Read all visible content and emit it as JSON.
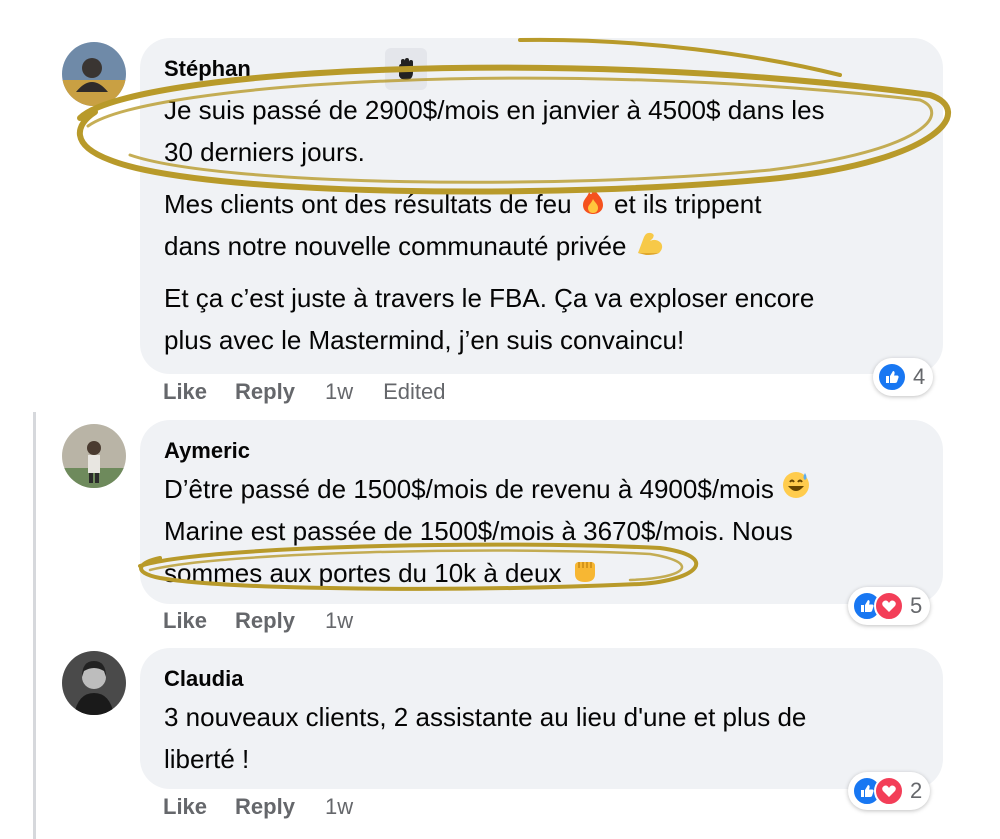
{
  "comments": [
    {
      "author": "Stéphan",
      "paragraphs": [
        [
          "Je suis passé de 2900$/mois en janvier à 4500$ dans les",
          "30 derniers jours."
        ],
        [
          "Mes clients ont des résultats de feu",
          "et ils trippent",
          "dans notre nouvelle communauté privée"
        ],
        [
          "Et ça c’est juste à travers le FBA. Ça va exploser encore",
          "plus avec le Mastermind, j’en suis convaincu!"
        ]
      ],
      "actions": {
        "like": "Like",
        "reply": "Reply",
        "time": "1w",
        "edited": "Edited"
      },
      "reactions": {
        "count": "4",
        "types": [
          "like"
        ]
      }
    },
    {
      "author": "Aymeric",
      "lines": [
        "D’être passé de 1500$/mois de revenu à 4900$/mois",
        "Marine est passée de 1500$/mois à 3670$/mois. Nous",
        "sommes aux portes du 10k à deux"
      ],
      "actions": {
        "like": "Like",
        "reply": "Reply",
        "time": "1w"
      },
      "reactions": {
        "count": "5",
        "types": [
          "like",
          "love"
        ]
      }
    },
    {
      "author": "Claudia",
      "lines": [
        "3 nouveaux clients, 2 assistante au lieu d'une et plus de",
        "liberté !"
      ],
      "actions": {
        "like": "Like",
        "reply": "Reply",
        "time": "1w"
      },
      "reactions": {
        "count": "2",
        "types": [
          "like",
          "love"
        ]
      }
    }
  ],
  "colors": {
    "bubble": "#f0f2f5",
    "muted_text": "#65676b",
    "like_blue": "#1877f2",
    "love_red": "#f33e58",
    "annotation_gold": "#b89a2a"
  },
  "icons": [
    "waving-hand-icon",
    "fire-icon",
    "flexed-biceps-icon",
    "grinning-sweat-icon",
    "raised-fist-icon",
    "like-reaction-icon",
    "love-reaction-icon"
  ]
}
